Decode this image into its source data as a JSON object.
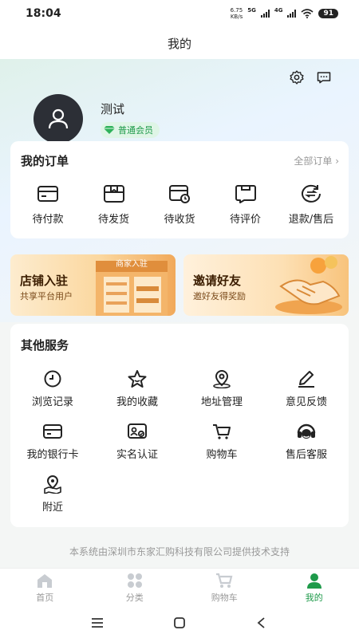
{
  "status": {
    "time": "18:04",
    "net_speed_value": "6.75",
    "net_speed_unit": "KB/s",
    "sig1": "5G",
    "sig2": "4G",
    "battery": "91"
  },
  "header": {
    "title": "我的"
  },
  "icons": {
    "settings": "settings-gear-icon",
    "messages": "message-icon"
  },
  "profile": {
    "name": "测试",
    "member_level": "普通会员"
  },
  "orders": {
    "title": "我的订单",
    "all_link": "全部订单",
    "items": [
      {
        "label": "待付款",
        "icon": "card-icon"
      },
      {
        "label": "待发货",
        "icon": "box-icon"
      },
      {
        "label": "待收货",
        "icon": "delivery-icon"
      },
      {
        "label": "待评价",
        "icon": "review-icon"
      },
      {
        "label": "退款/售后",
        "icon": "refund-icon"
      }
    ]
  },
  "banners": [
    {
      "title": "店铺入驻",
      "subtitle": "共享平台用户",
      "sign": "商家入驻"
    },
    {
      "title": "邀请好友",
      "subtitle": "邀好友得奖励"
    }
  ],
  "services": {
    "title": "其他服务",
    "items": [
      {
        "label": "浏览记录",
        "icon": "history-icon"
      },
      {
        "label": "我的收藏",
        "icon": "star-icon"
      },
      {
        "label": "地址管理",
        "icon": "location-icon"
      },
      {
        "label": "意见反馈",
        "icon": "edit-icon"
      },
      {
        "label": "我的银行卡",
        "icon": "bank-card-icon"
      },
      {
        "label": "实名认证",
        "icon": "id-card-icon"
      },
      {
        "label": "购物车",
        "icon": "cart-icon"
      },
      {
        "label": "售后客服",
        "icon": "headset-icon"
      },
      {
        "label": "附近",
        "icon": "nearby-icon"
      }
    ]
  },
  "footer": {
    "text": "本系统由深圳市东家汇购科技有限公司提供技术支持"
  },
  "tabs": [
    {
      "label": "首页",
      "icon": "home-icon"
    },
    {
      "label": "分类",
      "icon": "category-icon"
    },
    {
      "label": "购物车",
      "icon": "cart-icon"
    },
    {
      "label": "我的",
      "icon": "user-icon",
      "active": true
    }
  ],
  "colors": {
    "accent": "#1e9a4a",
    "text": "#222222",
    "muted": "#999999"
  }
}
